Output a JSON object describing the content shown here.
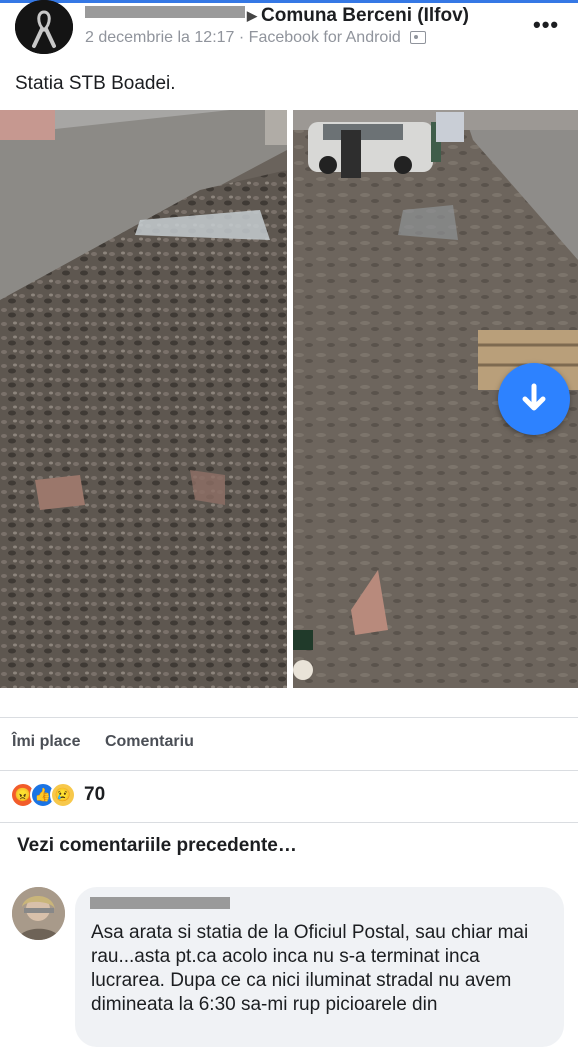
{
  "post": {
    "group_name": "Comuna Berceni (Ilfov)",
    "date": "2 decembrie la 12:17",
    "source": "Facebook for Android",
    "text": "Statia STB Boadei."
  },
  "actions": {
    "like": "Îmi place",
    "comment": "Comentariu"
  },
  "reactions": {
    "icons": [
      "angry-reaction-icon",
      "like-reaction-icon",
      "sad-reaction-icon"
    ],
    "count": "70"
  },
  "comments": {
    "previous_link": "Vezi comentariile precedente…",
    "items": [
      {
        "text": "Asa arata si statia de la Oficiul Postal, sau chiar mai rau...asta pt.ca acolo inca nu s-a terminat inca lucrarea. Dupa ce ca nici iluminat stradal nu avem dimineata la 6:30 sa-mi rup picioarele din"
      }
    ]
  },
  "colors": {
    "accent": "#2d82ff",
    "top_line": "#3578e5",
    "meta": "#90949c",
    "bubble": "#f0f2f5"
  }
}
